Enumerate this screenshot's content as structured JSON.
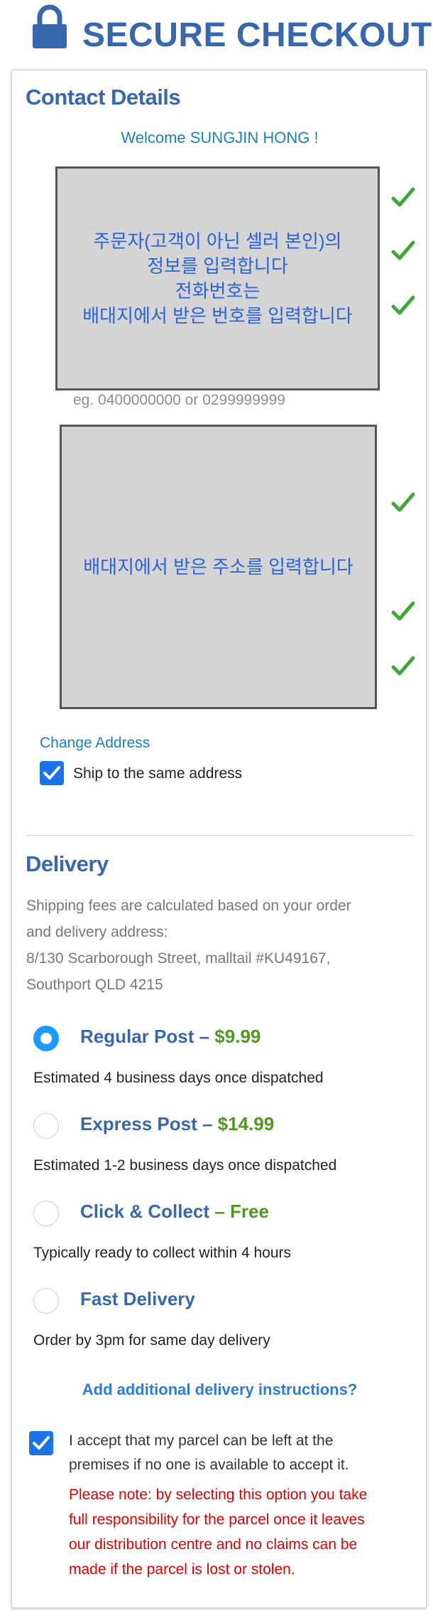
{
  "header": {
    "title": "SECURE CHECKOUT",
    "icon": "lock-icon",
    "accent_color": "#3767ad"
  },
  "contact": {
    "title": "Contact Details",
    "welcome": "Welcome SUNGJIN HONG !",
    "box1_lines": [
      "주문자(고객이 아닌 셀러 본인)의",
      "정보를 입력합니다",
      "전화번호는",
      "배대지에서 받은 번호를 입력합니다"
    ],
    "phone_hint": "eg. 0400000000 or 0299999999",
    "box2_text": "배대지에서 받은 주소를 입력합니다",
    "change_address": "Change Address",
    "same_address_label": "Ship to the same address",
    "same_address_checked": true
  },
  "delivery": {
    "title": "Delivery",
    "info_lines": [
      "Shipping fees are calculated based on your order",
      "and delivery address:",
      "8/130 Scarborough Street, malltail #KU49167,",
      "Southport QLD 4215"
    ],
    "options": [
      {
        "name": "Regular Post",
        "sep": " – ",
        "price": "$9.99",
        "desc": "Estimated 4 business days once dispatched",
        "selected": true
      },
      {
        "name": "Express Post",
        "sep": " – ",
        "price": "$14.99",
        "desc": "Estimated 1-2 business days once dispatched",
        "selected": false
      },
      {
        "name": "Click & Collect",
        "sep": " – ",
        "price": "Free",
        "desc": "Typically ready to collect within 4 hours",
        "selected": false
      },
      {
        "name": "Fast Delivery",
        "sep": "",
        "price": "",
        "desc": "Order by 3pm for same day delivery",
        "selected": false
      }
    ],
    "add_instructions": "Add additional delivery instructions?",
    "accept_lines": [
      "I accept that my parcel can be left at the",
      "premises if no one is available to accept it."
    ],
    "accept_checked": true,
    "warning_lines": [
      "Please note: by selecting this option you take",
      "full responsibility for the parcel once it leaves",
      "our distribution centre and no claims can be",
      "made if the parcel is lost or stolen."
    ]
  },
  "colors": {
    "price_green": "#4e9a1e",
    "warning_red": "#e00000",
    "link_blue": "#1d7fbd",
    "check_green": "#3fa63a"
  }
}
